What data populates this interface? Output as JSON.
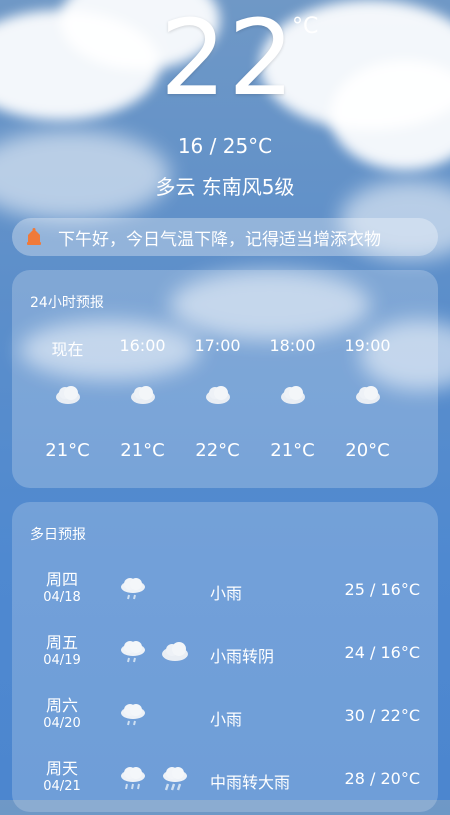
{
  "current": {
    "temperature": "22",
    "unit": "°C",
    "range": "16 / 25°C",
    "condition": "多云 东南风5级"
  },
  "tip": {
    "icon": "alert-icon",
    "text": "下午好，今日气温下降，记得适当增添衣物"
  },
  "hourly": {
    "title": "24小时预报",
    "items": [
      {
        "time": "现在",
        "icon": "cloud-icon",
        "temp": "21°C"
      },
      {
        "time": "16:00",
        "icon": "cloud-icon",
        "temp": "21°C"
      },
      {
        "time": "17:00",
        "icon": "cloud-icon",
        "temp": "22°C"
      },
      {
        "time": "18:00",
        "icon": "cloud-icon",
        "temp": "21°C"
      },
      {
        "time": "19:00",
        "icon": "cloud-icon",
        "temp": "20°C"
      }
    ]
  },
  "daily": {
    "title": "多日预报",
    "items": [
      {
        "weekday": "周四",
        "date": "04/18",
        "icons": [
          "light-rain-icon"
        ],
        "desc": "小雨",
        "range": "25 / 16°C"
      },
      {
        "weekday": "周五",
        "date": "04/19",
        "icons": [
          "light-rain-icon",
          "cloud-icon"
        ],
        "desc": "小雨转阴",
        "range": "24 / 16°C"
      },
      {
        "weekday": "周六",
        "date": "04/20",
        "icons": [
          "light-rain-icon"
        ],
        "desc": "小雨",
        "range": "30 / 22°C"
      },
      {
        "weekday": "周天",
        "date": "04/21",
        "icons": [
          "moderate-rain-icon",
          "heavy-rain-icon"
        ],
        "desc": "中雨转大雨",
        "range": "28 / 20°C"
      }
    ]
  },
  "colors": {
    "sky_top": "#6f98c6",
    "sky_bottom": "#4c86cf",
    "alert_orange": "#f07a3a"
  }
}
